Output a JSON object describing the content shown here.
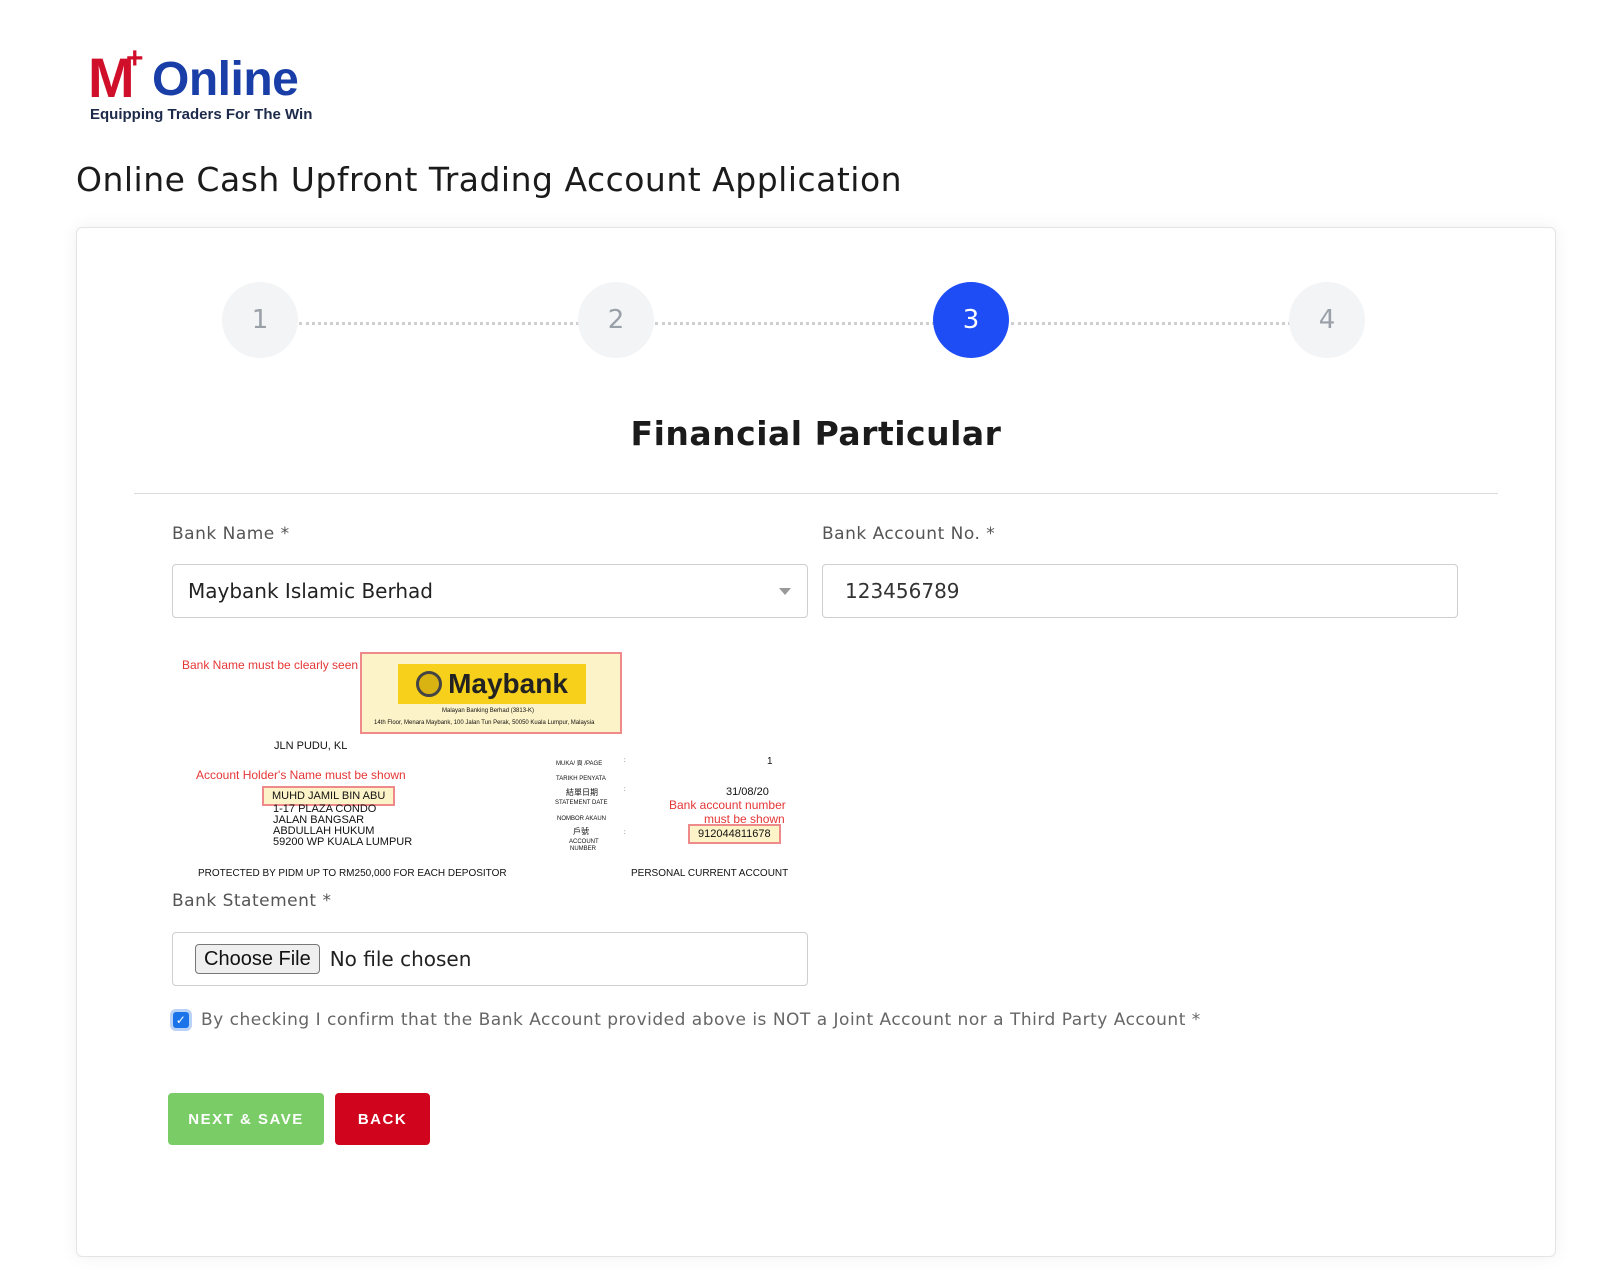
{
  "logo": {
    "m": "M",
    "plus": "+",
    "online": "Online",
    "tagline": "Equipping Traders For The Win"
  },
  "page_title": "Online Cash Upfront Trading Account Application",
  "stepper": {
    "steps": [
      "1",
      "2",
      "3",
      "4"
    ],
    "active": "3"
  },
  "section_title": "Financial Particular",
  "form": {
    "bank_name_label": "Bank Name *",
    "bank_name_value": "Maybank Islamic Berhad",
    "account_no_label": "Bank Account No. *",
    "account_no_value": "123456789",
    "statement_label": "Bank Statement *",
    "file_button": "Choose File",
    "file_status": "No file chosen",
    "confirm_checked": true,
    "confirm_text": "By checking I confirm that the Bank Account provided above is NOT a Joint Account nor a Third Party Account *"
  },
  "sample_statement": {
    "note_bank_name": "Bank Name must be clearly seen",
    "bank_logo_text": "Maybank",
    "bank_legal": "Malayan Banking Berhad (3813-K)",
    "bank_address": "14th Floor, Menara Maybank, 100 Jalan Tun Perak, 50050 Kuala Lumpur, Malaysia",
    "branch": "JLN PUDU, KL",
    "note_holder": "Account Holder's Name must be shown",
    "holder_name": "MUHD JAMIL BIN ABU",
    "address_lines": [
      "1-17 PLAZA CONDO",
      "JALAN BANGSAR",
      "ABDULLAH HUKUM",
      "59200 WP KUALA LUMPUR"
    ],
    "page_label": "MUKA/ 頁 /PAGE",
    "page_value": "1",
    "date_label_1": "TARIKH PENYATA",
    "date_label_2": "結單日期",
    "date_label_3": "STATEMENT DATE",
    "date_value": "31/08/20",
    "acct_label_1": "NOMBOR AKAUN",
    "acct_label_2": "戶號",
    "acct_label_3": "ACCOUNT",
    "acct_label_4": "NUMBER",
    "colon": ":",
    "note_account_1": "Bank account number",
    "note_account_2": "must be shown",
    "account_number": "912044811678",
    "footer_left": "PROTECTED BY PIDM UP TO RM250,000 FOR EACH DEPOSITOR",
    "footer_right": "PERSONAL CURRENT ACCOUNT"
  },
  "buttons": {
    "next": "NEXT & SAVE",
    "back": "BACK"
  },
  "colors": {
    "active_step": "#1e4df5",
    "next_button": "#7acc67",
    "back_button": "#d0041d",
    "logo_red": "#d0102b",
    "logo_blue": "#1a3ea8"
  },
  "icons": {
    "dropdown": "caret-down-icon",
    "checkbox": "checkmark-icon"
  }
}
